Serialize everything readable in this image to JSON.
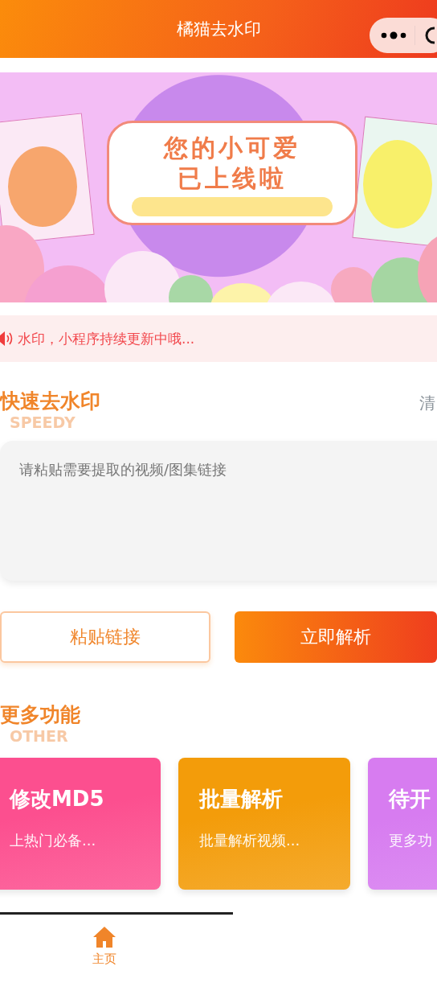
{
  "navbar": {
    "title": "橘猫去水印"
  },
  "banner": {
    "lines": [
      "您的小可爱",
      "已上线啦"
    ]
  },
  "notice": {
    "text": "水印，小程序持续更新中哦..."
  },
  "quick": {
    "title": "快速去水印",
    "watermark": "SPEEDY",
    "action": "清",
    "placeholder": "请粘贴需要提取的视频/图集链接"
  },
  "buttons": [
    {
      "label": "粘贴链接",
      "kind": "outline"
    },
    {
      "label": "立即解析",
      "kind": "primary"
    }
  ],
  "more": {
    "title": "更多功能",
    "watermark": "OTHER"
  },
  "features": [
    {
      "title": "修改MD5",
      "subtitle": "上热门必备...",
      "color": "#fc4f8f"
    },
    {
      "title": "批量解析",
      "subtitle": "批量解析视频...",
      "color": "#f39c0a"
    },
    {
      "title": "待开",
      "subtitle": "更多功",
      "color": "#d77cf0"
    }
  ],
  "tabbar": [
    {
      "label": "主页",
      "selected": true
    }
  ]
}
